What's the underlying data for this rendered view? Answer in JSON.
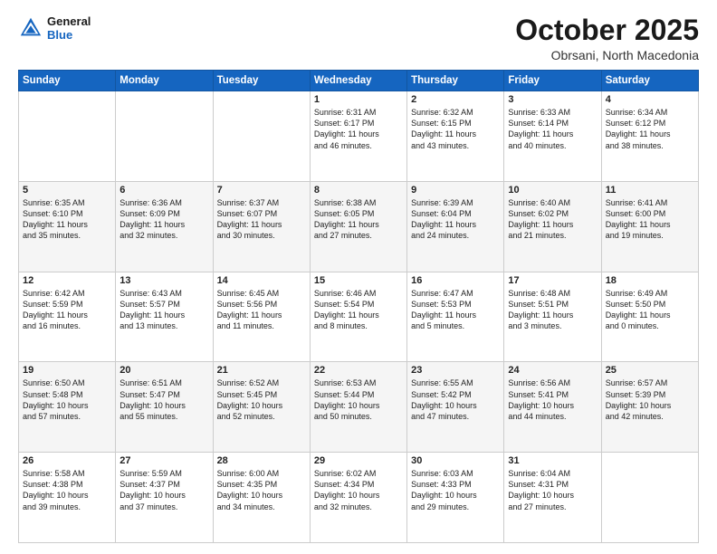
{
  "header": {
    "logo_line1": "General",
    "logo_line2": "Blue",
    "month": "October 2025",
    "location": "Obrsani, North Macedonia"
  },
  "weekdays": [
    "Sunday",
    "Monday",
    "Tuesday",
    "Wednesday",
    "Thursday",
    "Friday",
    "Saturday"
  ],
  "weeks": [
    [
      {
        "day": "",
        "info": ""
      },
      {
        "day": "",
        "info": ""
      },
      {
        "day": "",
        "info": ""
      },
      {
        "day": "1",
        "info": "Sunrise: 6:31 AM\nSunset: 6:17 PM\nDaylight: 11 hours\nand 46 minutes."
      },
      {
        "day": "2",
        "info": "Sunrise: 6:32 AM\nSunset: 6:15 PM\nDaylight: 11 hours\nand 43 minutes."
      },
      {
        "day": "3",
        "info": "Sunrise: 6:33 AM\nSunset: 6:14 PM\nDaylight: 11 hours\nand 40 minutes."
      },
      {
        "day": "4",
        "info": "Sunrise: 6:34 AM\nSunset: 6:12 PM\nDaylight: 11 hours\nand 38 minutes."
      }
    ],
    [
      {
        "day": "5",
        "info": "Sunrise: 6:35 AM\nSunset: 6:10 PM\nDaylight: 11 hours\nand 35 minutes."
      },
      {
        "day": "6",
        "info": "Sunrise: 6:36 AM\nSunset: 6:09 PM\nDaylight: 11 hours\nand 32 minutes."
      },
      {
        "day": "7",
        "info": "Sunrise: 6:37 AM\nSunset: 6:07 PM\nDaylight: 11 hours\nand 30 minutes."
      },
      {
        "day": "8",
        "info": "Sunrise: 6:38 AM\nSunset: 6:05 PM\nDaylight: 11 hours\nand 27 minutes."
      },
      {
        "day": "9",
        "info": "Sunrise: 6:39 AM\nSunset: 6:04 PM\nDaylight: 11 hours\nand 24 minutes."
      },
      {
        "day": "10",
        "info": "Sunrise: 6:40 AM\nSunset: 6:02 PM\nDaylight: 11 hours\nand 21 minutes."
      },
      {
        "day": "11",
        "info": "Sunrise: 6:41 AM\nSunset: 6:00 PM\nDaylight: 11 hours\nand 19 minutes."
      }
    ],
    [
      {
        "day": "12",
        "info": "Sunrise: 6:42 AM\nSunset: 5:59 PM\nDaylight: 11 hours\nand 16 minutes."
      },
      {
        "day": "13",
        "info": "Sunrise: 6:43 AM\nSunset: 5:57 PM\nDaylight: 11 hours\nand 13 minutes."
      },
      {
        "day": "14",
        "info": "Sunrise: 6:45 AM\nSunset: 5:56 PM\nDaylight: 11 hours\nand 11 minutes."
      },
      {
        "day": "15",
        "info": "Sunrise: 6:46 AM\nSunset: 5:54 PM\nDaylight: 11 hours\nand 8 minutes."
      },
      {
        "day": "16",
        "info": "Sunrise: 6:47 AM\nSunset: 5:53 PM\nDaylight: 11 hours\nand 5 minutes."
      },
      {
        "day": "17",
        "info": "Sunrise: 6:48 AM\nSunset: 5:51 PM\nDaylight: 11 hours\nand 3 minutes."
      },
      {
        "day": "18",
        "info": "Sunrise: 6:49 AM\nSunset: 5:50 PM\nDaylight: 11 hours\nand 0 minutes."
      }
    ],
    [
      {
        "day": "19",
        "info": "Sunrise: 6:50 AM\nSunset: 5:48 PM\nDaylight: 10 hours\nand 57 minutes."
      },
      {
        "day": "20",
        "info": "Sunrise: 6:51 AM\nSunset: 5:47 PM\nDaylight: 10 hours\nand 55 minutes."
      },
      {
        "day": "21",
        "info": "Sunrise: 6:52 AM\nSunset: 5:45 PM\nDaylight: 10 hours\nand 52 minutes."
      },
      {
        "day": "22",
        "info": "Sunrise: 6:53 AM\nSunset: 5:44 PM\nDaylight: 10 hours\nand 50 minutes."
      },
      {
        "day": "23",
        "info": "Sunrise: 6:55 AM\nSunset: 5:42 PM\nDaylight: 10 hours\nand 47 minutes."
      },
      {
        "day": "24",
        "info": "Sunrise: 6:56 AM\nSunset: 5:41 PM\nDaylight: 10 hours\nand 44 minutes."
      },
      {
        "day": "25",
        "info": "Sunrise: 6:57 AM\nSunset: 5:39 PM\nDaylight: 10 hours\nand 42 minutes."
      }
    ],
    [
      {
        "day": "26",
        "info": "Sunrise: 5:58 AM\nSunset: 4:38 PM\nDaylight: 10 hours\nand 39 minutes."
      },
      {
        "day": "27",
        "info": "Sunrise: 5:59 AM\nSunset: 4:37 PM\nDaylight: 10 hours\nand 37 minutes."
      },
      {
        "day": "28",
        "info": "Sunrise: 6:00 AM\nSunset: 4:35 PM\nDaylight: 10 hours\nand 34 minutes."
      },
      {
        "day": "29",
        "info": "Sunrise: 6:02 AM\nSunset: 4:34 PM\nDaylight: 10 hours\nand 32 minutes."
      },
      {
        "day": "30",
        "info": "Sunrise: 6:03 AM\nSunset: 4:33 PM\nDaylight: 10 hours\nand 29 minutes."
      },
      {
        "day": "31",
        "info": "Sunrise: 6:04 AM\nSunset: 4:31 PM\nDaylight: 10 hours\nand 27 minutes."
      },
      {
        "day": "",
        "info": ""
      }
    ]
  ]
}
